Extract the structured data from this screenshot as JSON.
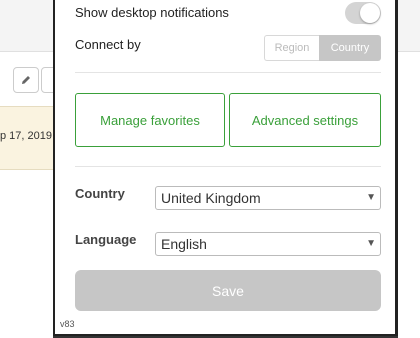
{
  "background": {
    "date_text": "p 17, 2019",
    "toolbar_icons": [
      "pencil-icon",
      "toolbar-button"
    ]
  },
  "popup": {
    "notifications": {
      "label": "Show desktop notifications",
      "enabled": true
    },
    "connect_by": {
      "label": "Connect by",
      "options": [
        "Region",
        "Country"
      ],
      "selected": "Country"
    },
    "buttons": {
      "manage_favorites": "Manage favorites",
      "advanced_settings": "Advanced settings"
    },
    "country": {
      "label": "Country",
      "value": "United Kingdom"
    },
    "language": {
      "label": "Language",
      "value": "English"
    },
    "save_label": "Save",
    "version": "v83"
  },
  "colors": {
    "accent_green": "#3aa03a",
    "disabled_gray": "#c6c6c6"
  }
}
